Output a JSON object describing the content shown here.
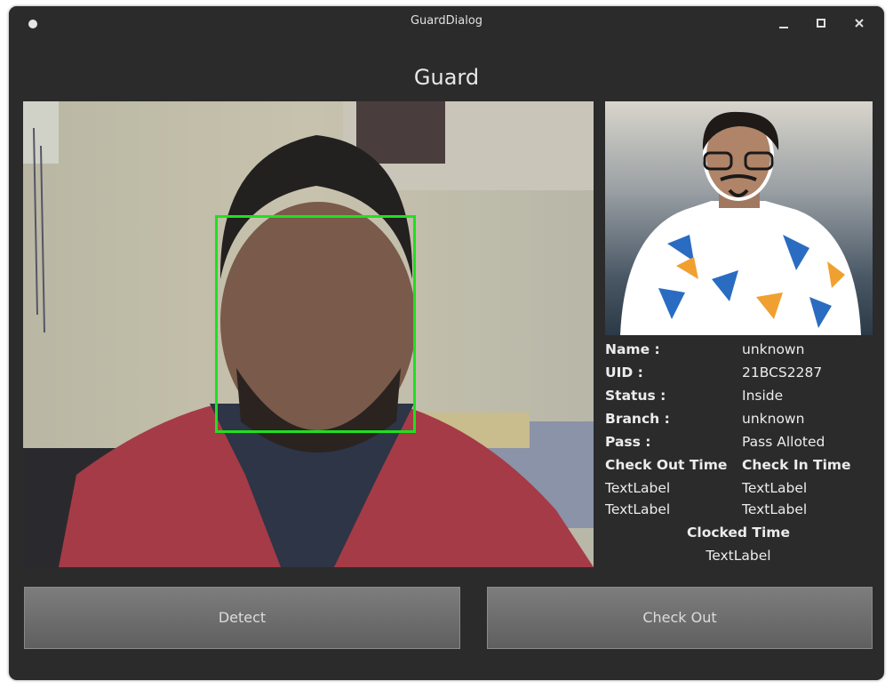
{
  "window": {
    "title": "GuardDialog"
  },
  "heading": "Guard",
  "profile": {
    "name_label": "Name :",
    "name_value": "unknown",
    "uid_label": "UID :",
    "uid_value": "21BCS2287",
    "status_label": "Status :",
    "status_value": "Inside",
    "branch_label": "Branch :",
    "branch_value": "unknown",
    "pass_label": "Pass :",
    "pass_value": "Pass Alloted"
  },
  "times": {
    "check_out_header": "Check Out Time",
    "check_in_header": "Check In Time",
    "check_out_1": "TextLabel",
    "check_in_1": "TextLabel",
    "check_out_2": "TextLabel",
    "check_in_2": "TextLabel",
    "clocked_header": "Clocked Time",
    "clocked_value": "TextLabel"
  },
  "buttons": {
    "detect": "Detect",
    "check_out": "Check Out"
  },
  "colors": {
    "face_box": "#1fe01f",
    "window_bg": "#2b2b2b"
  }
}
